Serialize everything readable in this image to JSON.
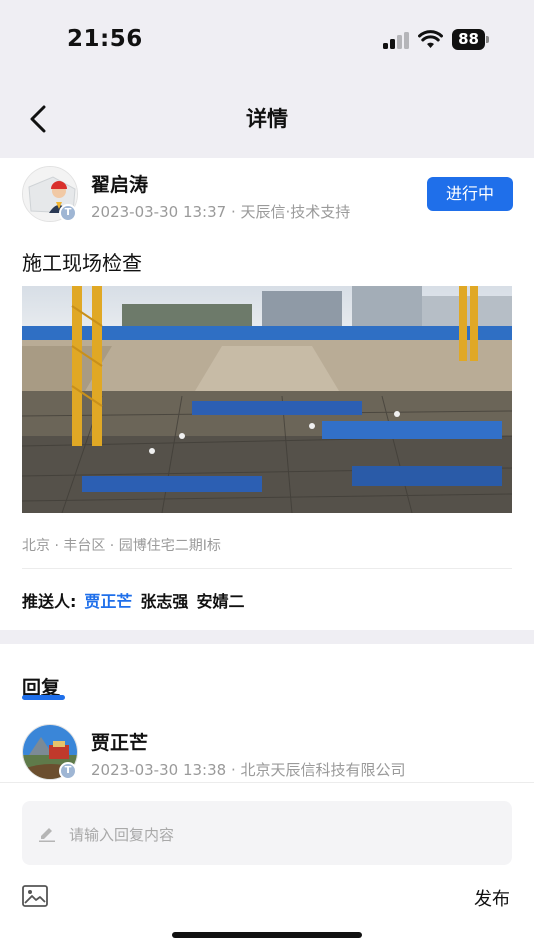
{
  "status_bar": {
    "time": "21:56",
    "battery": "88"
  },
  "nav": {
    "title": "详情"
  },
  "post": {
    "author": "翟启涛",
    "timestamp": "2023-03-30 13:37",
    "org": "天辰信·技术支持",
    "badge": "T",
    "status": "进行中",
    "title": "施工现场检查",
    "location": "北京 · 丰台区 · 园博住宅二期I标",
    "push_label": "推送人:",
    "push_users": [
      "贾正芒",
      "张志强",
      "安婧二"
    ]
  },
  "reply": {
    "heading": "回复",
    "author": "贾正芒",
    "timestamp": "2023-03-30 13:38",
    "org": "北京天辰信科技有限公司",
    "badge": "T"
  },
  "composer": {
    "placeholder": "请输入回复内容",
    "publish_label": "发布"
  },
  "colors": {
    "accent": "#1f6fea",
    "background": "#efeef3"
  }
}
